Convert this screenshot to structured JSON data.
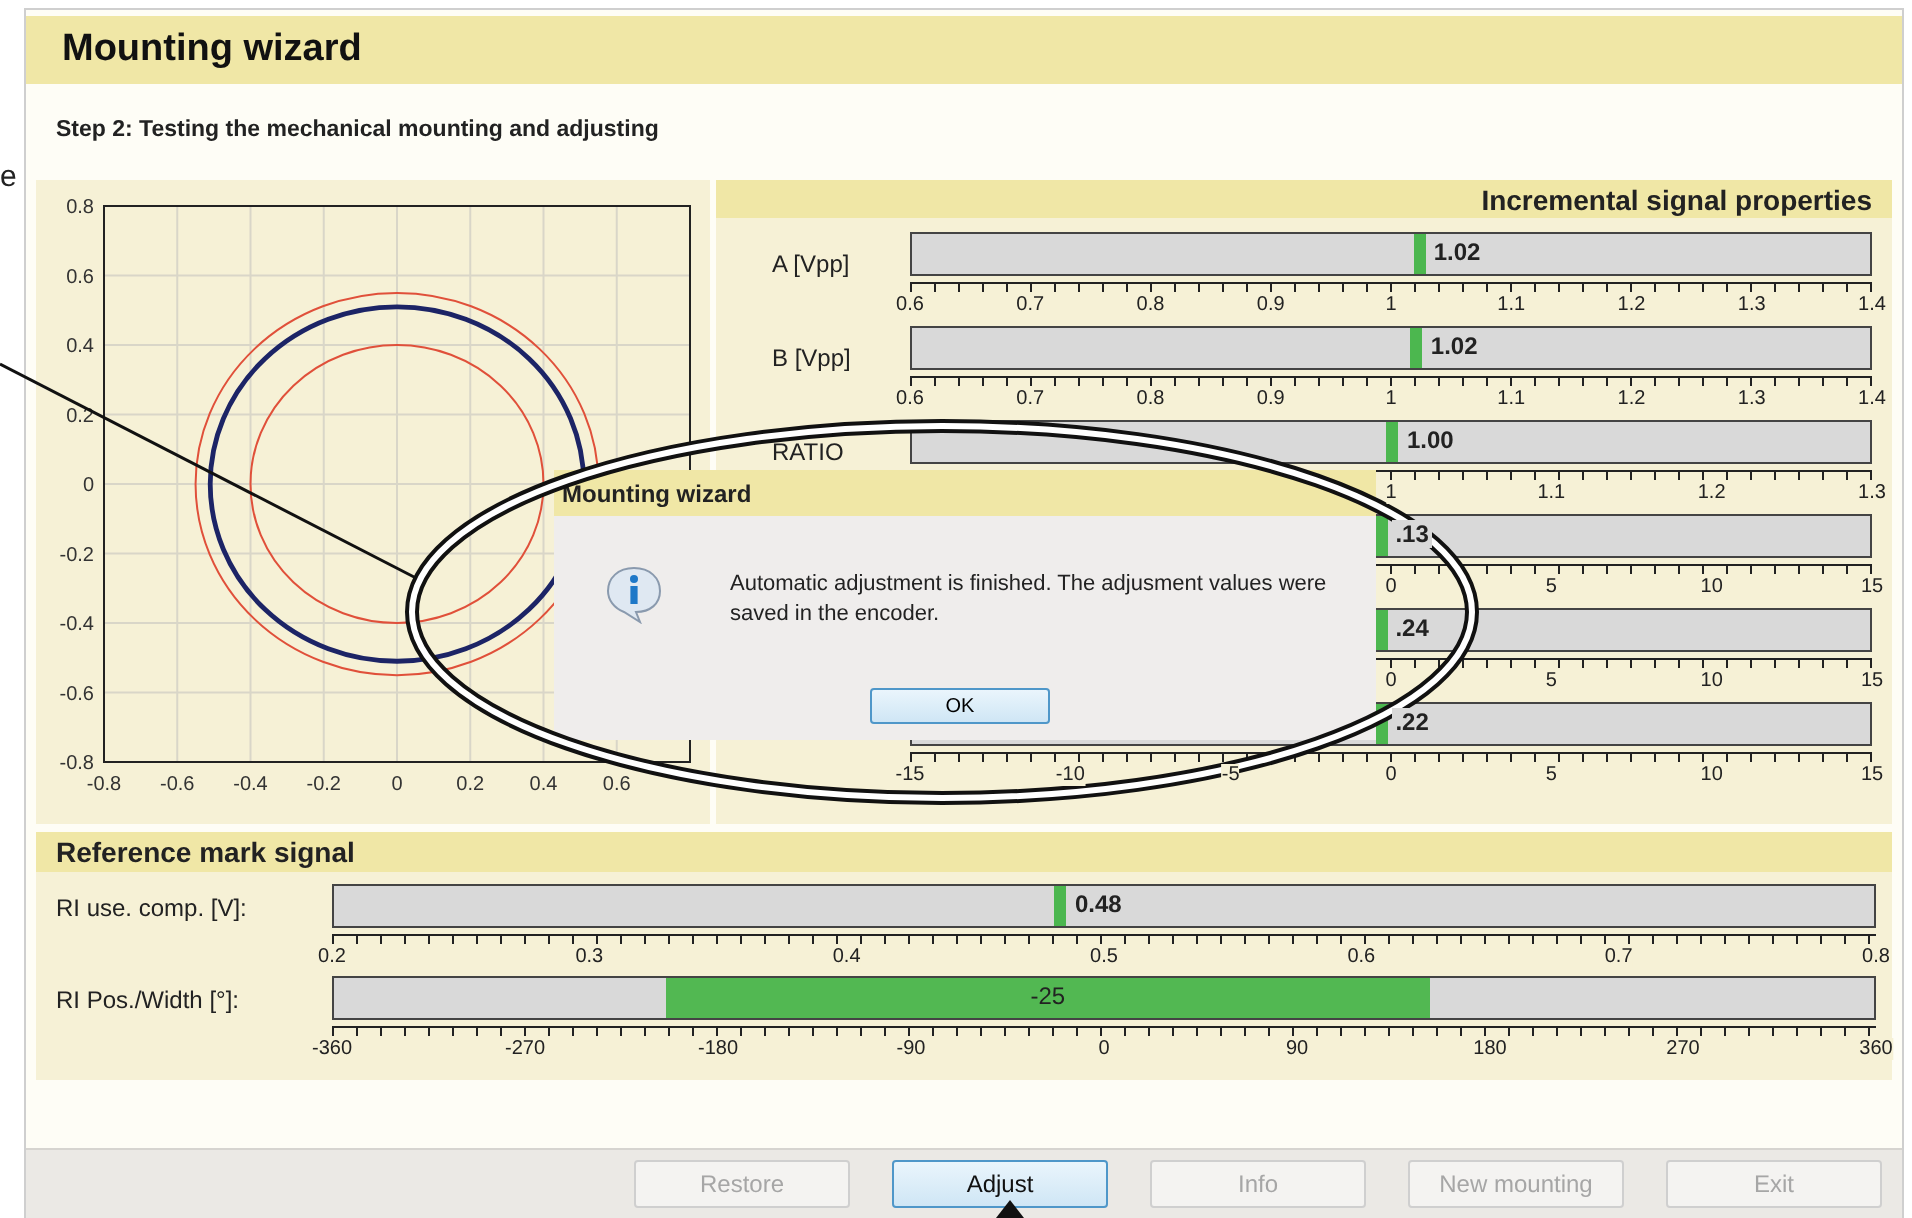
{
  "side_note": "e",
  "wizard": {
    "title": "Mounting wizard",
    "step": "Step 2: Testing the mechanical mounting and adjusting"
  },
  "plot": {
    "chart_data": {
      "type": "line",
      "grid": true,
      "xlim": [
        -0.8,
        0.8
      ],
      "ylim": [
        -0.8,
        0.8
      ],
      "xticks": [
        -0.8,
        -0.6,
        -0.4,
        -0.2,
        0,
        0.2,
        0.4,
        0.6
      ],
      "yticks": [
        -0.8,
        -0.6,
        -0.4,
        -0.2,
        0,
        0.2,
        0.4,
        0.6,
        0.8
      ]
    }
  },
  "incremental": {
    "title": "Incremental signal properties",
    "rows": [
      {
        "label": "A [Vpp]",
        "value": "1.02",
        "level": 0.53,
        "ticks": [
          "0.6",
          "0.7",
          "0.8",
          "0.9",
          "1",
          "1.1",
          "1.2",
          "1.3",
          "1.4"
        ]
      },
      {
        "label": "B [Vpp]",
        "value": "1.02",
        "level": 0.527,
        "ticks": [
          "0.6",
          "0.7",
          "0.8",
          "0.9",
          "1",
          "1.1",
          "1.2",
          "1.3",
          "1.4"
        ]
      },
      {
        "label": "RATIO",
        "value": "1.00",
        "level": 0.502,
        "ticks": [
          "1",
          "1.1",
          "1.2",
          "1.3"
        ]
      },
      {
        "value": ".13",
        "level": 0.49,
        "ticks": [
          "0",
          "5",
          "10",
          "15"
        ]
      },
      {
        "value": ".24",
        "level": 0.49,
        "ticks": [
          "0",
          "5",
          "10",
          "15"
        ]
      },
      {
        "value": ".22",
        "level": 0.49,
        "ticks": [
          "-15",
          "-10",
          "-5",
          "0",
          "5",
          "10",
          "15"
        ]
      }
    ]
  },
  "reference": {
    "title": "Reference mark signal",
    "rows": [
      {
        "kind": "marker",
        "label": "RI use. comp. [V]:",
        "value": "0.48",
        "level": 0.472,
        "ticks": [
          "0.2",
          "0.3",
          "0.4",
          "0.5",
          "0.6",
          "0.7",
          "0.8"
        ]
      },
      {
        "kind": "window",
        "label": "RI Pos./Width [°]:",
        "value": "-25",
        "start": {
          "level": 0.215
        },
        "end": {
          "level": 0.712
        },
        "ticks": [
          "-360",
          "-270",
          "-180",
          "-90",
          "0",
          "90",
          "180",
          "270",
          "360"
        ]
      }
    ]
  },
  "buttons": [
    {
      "label": "Restore",
      "disabled": true
    },
    {
      "label": "Adjust",
      "disabled": false
    },
    {
      "label": "Info",
      "disabled": true
    },
    {
      "label": "New mounting",
      "disabled": true
    },
    {
      "label": "Exit",
      "disabled": true
    }
  ],
  "dialog": {
    "title": "Mounting wizard",
    "message": "Automatic adjustment is finished. The adjusment values were saved in the encoder.",
    "ok": "OK"
  }
}
